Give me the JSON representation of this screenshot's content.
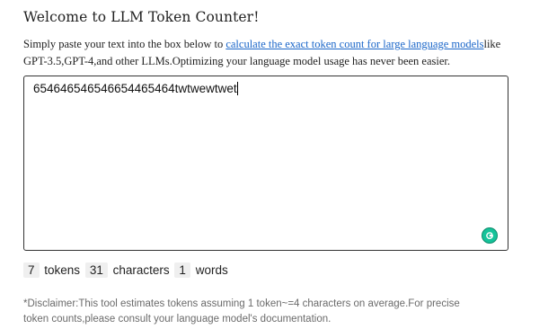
{
  "header": {
    "title": "Welcome to LLM Token Counter!"
  },
  "intro": {
    "before_link": "Simply paste your text into the box below to ",
    "link_text": "calculate the exact token count for large language models",
    "after_link": "like GPT-3.5,GPT-4,and other LLMs.Optimizing your language model usage has never been easier."
  },
  "editor": {
    "value": "65464654654665446546​4twtwewtwet",
    "grammarly_icon": "grammarly-icon"
  },
  "stats": {
    "tokens": "7",
    "tokens_label": "tokens",
    "characters": "31",
    "characters_label": "characters",
    "words": "1",
    "words_label": "words"
  },
  "disclaimer": "*Disclaimer:This tool estimates tokens assuming 1 token~=4 characters on average.For precise token counts,please consult your language model's documentation.",
  "colors": {
    "link": "#1a66c9",
    "grammarly": "#15c39a",
    "stat_bg": "#efefef"
  }
}
